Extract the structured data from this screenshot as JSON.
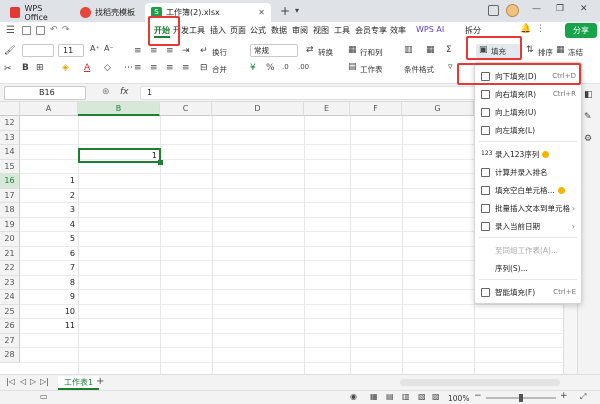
{
  "titlebar": {
    "tabs": [
      {
        "label": "WPS Office"
      },
      {
        "label": "找稻壳模板"
      },
      {
        "label": "工作簿(2).xlsx"
      }
    ],
    "new_tab": "+",
    "dropdown_arrow": "▾",
    "minimize": "—",
    "restore": "❐",
    "close": "✕"
  },
  "menu": {
    "items": [
      "开始",
      "开发工具",
      "插入",
      "页面",
      "公式",
      "数据",
      "审阅",
      "视图",
      "工具",
      "会员专享",
      "效率",
      "WPS AI",
      "拆分"
    ],
    "share": "分享"
  },
  "ribbon": {
    "font_size": "11",
    "wrap": "换行",
    "merge": "合并",
    "number_format": "常规",
    "convert": "转换",
    "rows_cols": "行和列",
    "worksheet": "工作表",
    "cond_format": "条件格式",
    "fill": "填充",
    "sort": "排序",
    "freeze": "冻结"
  },
  "formula_bar": {
    "cell_ref": "B16",
    "fx": "fx",
    "value": "1"
  },
  "grid": {
    "columns": [
      "A",
      "B",
      "C",
      "D",
      "E",
      "F",
      "G",
      "H"
    ],
    "rows": [
      "12",
      "13",
      "14",
      "15",
      "16",
      "17",
      "18",
      "19",
      "20",
      "21",
      "22",
      "23",
      "24",
      "25",
      "26",
      "27",
      "28"
    ],
    "a_values": [
      "",
      "",
      "",
      "",
      "1",
      "2",
      "3",
      "4",
      "5",
      "6",
      "7",
      "8",
      "9",
      "10",
      "11",
      "",
      ""
    ],
    "b16_value": "1"
  },
  "fill_menu": {
    "items": [
      {
        "label": "向下填充(D)",
        "shortcut": "Ctrl+D"
      },
      {
        "label": "向右填充(R)",
        "shortcut": "Ctrl+R"
      },
      {
        "label": "向上填充(U)",
        "shortcut": ""
      },
      {
        "label": "向左填充(L)",
        "shortcut": ""
      },
      {
        "label": "录入123序列",
        "shortcut": ""
      },
      {
        "label": "计算并录入排名",
        "shortcut": ""
      },
      {
        "label": "填充空白单元格...",
        "shortcut": ""
      },
      {
        "label": "批量插入文本到单元格",
        "shortcut": ""
      },
      {
        "label": "录入当前日期",
        "shortcut": ""
      },
      {
        "label": "至同组工作表(A)...",
        "shortcut": ""
      },
      {
        "label": "序列(S)...",
        "shortcut": ""
      },
      {
        "label": "智能填充(F)",
        "shortcut": "Ctrl+E"
      }
    ]
  },
  "sheetbar": {
    "sheet_name": "工作表1",
    "add": "+"
  },
  "statusbar": {
    "zoom": "100%"
  },
  "colors": {
    "accent_green": "#1e7e34",
    "highlight_red": "#e53935",
    "share_green": "#17a34a"
  }
}
